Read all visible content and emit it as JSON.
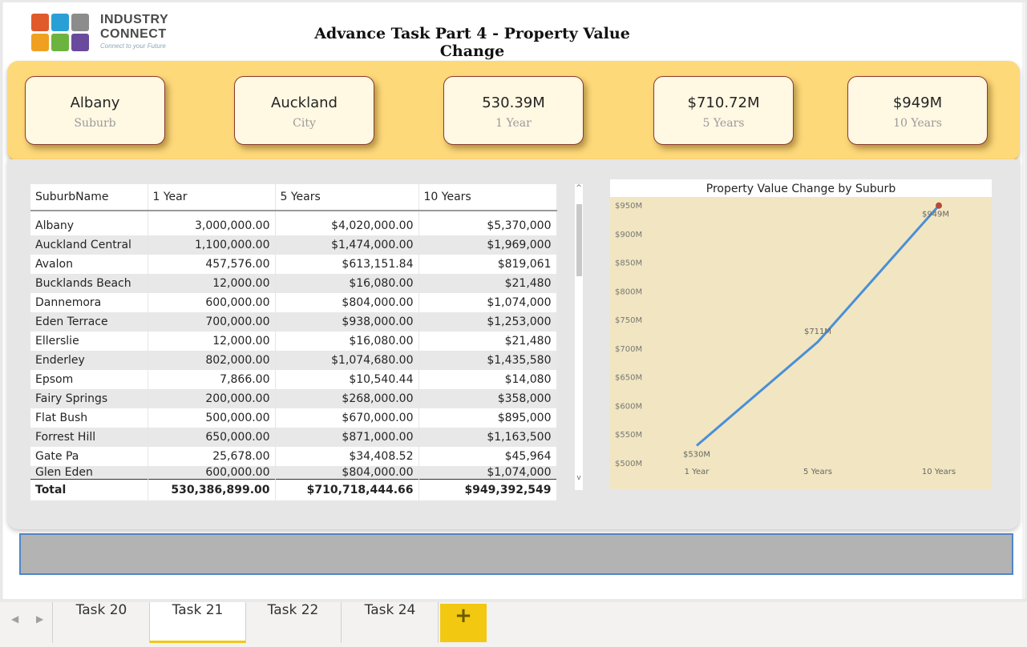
{
  "report": {
    "title": "Advance Task Part 4 - Property Value Change",
    "logo": {
      "line1": "INDUSTRY",
      "line2": "CONNECT",
      "tagline": "Connect to your Future"
    }
  },
  "kpi_cards": [
    {
      "value": "Albany",
      "label": "Suburb"
    },
    {
      "value": "Auckland",
      "label": "City"
    },
    {
      "value": "530.39M",
      "label": "1 Year"
    },
    {
      "value": "$710.72M",
      "label": "5 Years"
    },
    {
      "value": "$949M",
      "label": "10 Years"
    }
  ],
  "table": {
    "columns": [
      "SuburbName",
      "1 Year",
      "5 Years",
      "10 Years"
    ],
    "rows": [
      [
        "Albany",
        "3,000,000.00",
        "$4,020,000.00",
        "$5,370,000"
      ],
      [
        "Auckland Central",
        "1,100,000.00",
        "$1,474,000.00",
        "$1,969,000"
      ],
      [
        "Avalon",
        "457,576.00",
        "$613,151.84",
        "$819,061"
      ],
      [
        "Bucklands Beach",
        "12,000.00",
        "$16,080.00",
        "$21,480"
      ],
      [
        "Dannemora",
        "600,000.00",
        "$804,000.00",
        "$1,074,000"
      ],
      [
        "Eden Terrace",
        "700,000.00",
        "$938,000.00",
        "$1,253,000"
      ],
      [
        "Ellerslie",
        "12,000.00",
        "$16,080.00",
        "$21,480"
      ],
      [
        "Enderley",
        "802,000.00",
        "$1,074,680.00",
        "$1,435,580"
      ],
      [
        "Epsom",
        "7,866.00",
        "$10,540.44",
        "$14,080"
      ],
      [
        "Fairy Springs",
        "200,000.00",
        "$268,000.00",
        "$358,000"
      ],
      [
        "Flat Bush",
        "500,000.00",
        "$670,000.00",
        "$895,000"
      ],
      [
        "Forrest Hill",
        "650,000.00",
        "$871,000.00",
        "$1,163,500"
      ],
      [
        "Gate Pa",
        "25,678.00",
        "$34,408.52",
        "$45,964"
      ],
      [
        "Glen Eden",
        "600,000.00",
        "$804,000.00",
        "$1,074,000"
      ]
    ],
    "total": [
      "Total",
      "530,386,899.00",
      "$710,718,444.66",
      "$949,392,549"
    ],
    "scroll_up": "^",
    "scroll_down": "v"
  },
  "chart_data": {
    "type": "line",
    "title": "Property Value Change by Suburb",
    "categories": [
      "1 Year",
      "5 Years",
      "10 Years"
    ],
    "series": [
      {
        "values": [
          530,
          711,
          949
        ],
        "data_labels": [
          "$530M",
          "$711M",
          "$949M"
        ]
      }
    ],
    "y_ticks": [
      "$500M",
      "$550M",
      "$600M",
      "$650M",
      "$700M",
      "$750M",
      "$800M",
      "$850M",
      "$900M",
      "$950M"
    ],
    "ylim": [
      500,
      950
    ],
    "colors": {
      "line": "#4a8fd8",
      "plot_bg": "#f1e6c1",
      "end_marker": "#b9473a"
    }
  },
  "tabs": {
    "items": [
      "Task 20",
      "Task 21",
      "Task 22",
      "Task 24"
    ],
    "active": "Task 21",
    "add_label": "+",
    "prev_icon": "◀",
    "next_icon": "▶"
  },
  "colors": {
    "accent": "#f2c811",
    "kpi_band": "#fed97a",
    "card_border": "#8a3a2c"
  }
}
